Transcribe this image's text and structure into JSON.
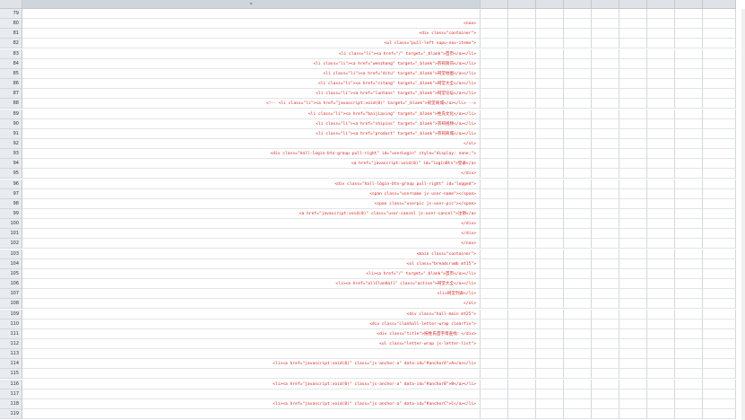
{
  "sheet": {
    "header_arrow": "▾",
    "rows": [
      {
        "num": "79",
        "code": ""
      },
      {
        "num": "80",
        "code": "<nav>"
      },
      {
        "num": "81",
        "code": "<div class=\"container\">"
      },
      {
        "num": "82",
        "code": "<ul class=\"pull-left supu-nav-items\">"
      },
      {
        "num": "83",
        "code": "<li class=\"li\"><a href=\"/\" target=\"_blank\">首页</a></li>"
      },
      {
        "num": "84",
        "code": "<li class=\"li\"><a href=\"wenzhang\" target=\"_blank\">宗祠资讯</a></li>"
      },
      {
        "num": "85",
        "code": "<li class=\"li\"><a href=\"ditu\" target=\"_blank\">祠堂地图</a></li>"
      },
      {
        "num": "86",
        "code": "<li class=\"li\"><a href=\"citang\" target=\"_blank\">祠堂大全</a></li>"
      },
      {
        "num": "87",
        "code": "<li class=\"li\"><a href=\"luntans\" target=\"_blank\">祠堂论坛</a></li>"
      },
      {
        "num": "88",
        "code": "<!-- <li class=\"li\"><a href=\"javascript:void(0)\" target=\"_blank\">祠堂商城</a></li> -->"
      },
      {
        "num": "89",
        "code": "<li class=\"li\"><a href=\"baijiaxing\" target=\"_blank\">姓氏文化</a></li>"
      },
      {
        "num": "90",
        "code": "<li class=\"li\"><a href=\"shipins\" target=\"_blank\">宗祠视频</a></li>"
      },
      {
        "num": "91",
        "code": "<li class=\"li\"><a href=\"product\" target=\"_blank\">宗祠商城</a></li>"
      },
      {
        "num": "92",
        "code": "</ul>"
      },
      {
        "num": "93",
        "code": "<div class=\"hall-login-btn-group pull-right\" id=\"userLogin\" style=\"display: none;\">"
      },
      {
        "num": "94",
        "code": "<a href=\"javascript:void(0)\" id=\"loginBtn\">登录</a>"
      },
      {
        "num": "95",
        "code": "</div>"
      },
      {
        "num": "96",
        "code": "<div class=\"hall-login-btn-group pull-right\" id=\"logged\">"
      },
      {
        "num": "97",
        "code": "<span class=\"username js-user-name\"></span>"
      },
      {
        "num": "98",
        "code": "<span class=\"userpic js-user-pic\"></span>"
      },
      {
        "num": "99",
        "code": "<a href=\"javascript:void(0)\" class=\"user-cancel js-user-cancel\">注销</a>"
      },
      {
        "num": "100",
        "code": "</div>"
      },
      {
        "num": "101",
        "code": "</div>"
      },
      {
        "num": "102",
        "code": "</nav>"
      },
      {
        "num": "103",
        "code": "<main class=\"container\">"
      },
      {
        "num": "104",
        "code": "<ol class=\"breadcrumb mt15\">"
      },
      {
        "num": "105",
        "code": "<li><a href=\"/\" target=\"_blank\">首页</a></li>"
      },
      {
        "num": "106",
        "code": "<li><a href=\"allClanHall\" class=\"active\">祠堂大全</a></li>"
      },
      {
        "num": "107",
        "code": "<li>祠堂列表</li>"
      },
      {
        "num": "108",
        "code": "</ol>"
      },
      {
        "num": "109",
        "code": "<div class=\"hall-main mt25\">"
      },
      {
        "num": "110",
        "code": "<div class=\"clanhall-letter-wrap clearfix\">"
      },
      {
        "num": "111",
        "code": "<div class=\"title\">按姓氏首字母查找：</div>"
      },
      {
        "num": "112",
        "code": "<ul class=\"letter-wrap js-letter-list\">"
      },
      {
        "num": "113",
        "code": ""
      },
      {
        "num": "114",
        "code": "<li><a href=\"javascript:void(0)\" class=\"js-anchor-a\" data-id=\"#anchorA\">A</a></li>"
      },
      {
        "num": "115",
        "code": ""
      },
      {
        "num": "116",
        "code": "<li><a href=\"javascript:void(0)\" class=\"js-anchor-a\" data-id=\"#anchorB\">B</a></li>"
      },
      {
        "num": "117",
        "code": ""
      },
      {
        "num": "118",
        "code": "<li><a href=\"javascript:void(0)\" class=\"js-anchor-a\" data-id=\"#anchorC\">C</a></li>"
      },
      {
        "num": "119",
        "code": ""
      }
    ]
  }
}
